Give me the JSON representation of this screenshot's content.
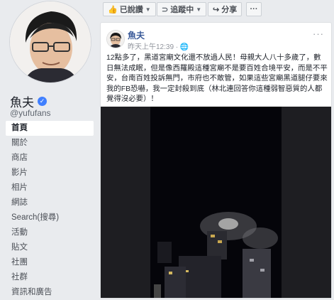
{
  "page": {
    "name": "魚夫",
    "handle": "@yufufans"
  },
  "nav": [
    {
      "label": "首頁",
      "active": true
    },
    {
      "label": "關於"
    },
    {
      "label": "商店"
    },
    {
      "label": "影片"
    },
    {
      "label": "相片"
    },
    {
      "label": "網誌"
    },
    {
      "label": "Search(搜尋)"
    },
    {
      "label": "活動"
    },
    {
      "label": "貼文"
    },
    {
      "label": "社團"
    },
    {
      "label": "社群"
    },
    {
      "label": "資訊和廣告"
    }
  ],
  "toolbar": {
    "liked_label": "已說讚",
    "follow_label": "追蹤中",
    "share_label": "分享",
    "more_label": "···"
  },
  "post": {
    "author": "魚夫",
    "timestamp": "昨天上午12:39",
    "text": "12點多了，黑道宮廟文化還不放過人民！母親大人八十多歲了，數日無法成眠，但是像西羅殿這種宮廟不是要百姓合境平安，而是不平安，台南百姓投訴無門，市府也不敢管，如果這些宮廟黑道腿仔要來我的FB恐嚇，我一定封殺到底（林北連回答你這種弱智惡質的人都覺得沒必要）！",
    "more_label": "···"
  },
  "colors": {
    "link": "#385898",
    "background": "#e9ebee",
    "verified": "#4080ff"
  }
}
